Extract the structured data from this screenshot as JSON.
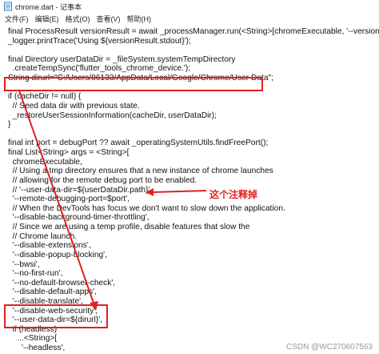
{
  "window": {
    "title": "chrome.dart - 记事本"
  },
  "menu": [
    "文件(F)",
    "编辑(E)",
    "格式(O)",
    "查看(V)",
    "帮助(H)"
  ],
  "code_lines": [
    "final ProcessResult versionResult = await _processManager.run(<String>[chromeExecutable, '--version']);",
    "_logger.printTrace('Using ${versionResult.stdout}');",
    "",
    "final Directory userDataDir = _fileSystem.systemTempDirectory",
    "  .createTempSync('flutter_tools_chrome_device.');",
    "String dirurl=\"C:/Users/86133/AppData/Local/Google/Chrome/User Data\";",
    "",
    "if (cacheDir != null) {",
    "  // Seed data dir with previous state.",
    "  _restoreUserSessionInformation(cacheDir, userDataDir);",
    "}",
    "",
    "final int port = debugPort ?? await _operatingSystemUtils.findFreePort();",
    "final List<String> args = <String>[",
    "  chromeExecutable,",
    "  // Using a tmp directory ensures that a new instance of chrome launches",
    "  // allowing for the remote debug port to be enabled.",
    "  // '--user-data-dir=${userDataDir.path}',",
    "  '--remote-debugging-port=$port',",
    "  // When the DevTools has focus we don't want to slow down the application.",
    "  '--disable-background-timer-throttling',",
    "  // Since we are using a temp profile, disable features that slow the",
    "  // Chrome launch.",
    "  '--disable-extensions',",
    "  '--disable-popup-blocking',",
    "  '--bwsi',",
    "  '--no-first-run',",
    "  '--no-default-browser-check',",
    "  '--disable-default-apps',",
    "  '--disable-translate',",
    "  '--disable-web-security',",
    "  '--user-data-dir=${dirurl}',",
    "  if (headless)",
    "    ...<String>[",
    "      '--headless',"
  ],
  "annotation": "这个注释掉",
  "watermark": "CSDN @WC270607563",
  "colors": {
    "highlight": "#e02020"
  }
}
